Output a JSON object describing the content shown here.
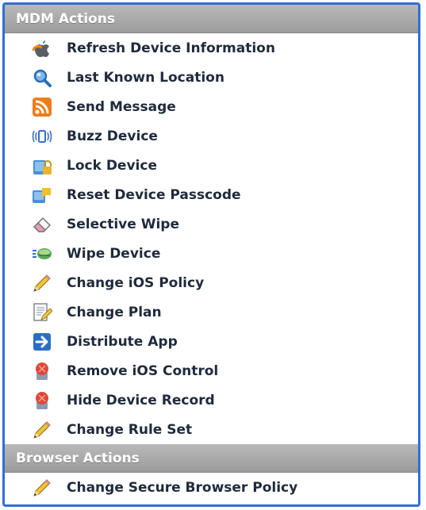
{
  "mdm": {
    "header": "MDM Actions",
    "items": [
      {
        "label": "Refresh Device Information",
        "icon": "apple-refresh-icon"
      },
      {
        "label": "Last Known Location",
        "icon": "magnifier-icon"
      },
      {
        "label": "Send Message",
        "icon": "rss-icon"
      },
      {
        "label": "Buzz Device",
        "icon": "vibrate-icon"
      },
      {
        "label": "Lock Device",
        "icon": "lock-icon"
      },
      {
        "label": "Reset Device Passcode",
        "icon": "passcode-icon"
      },
      {
        "label": "Selective Wipe",
        "icon": "eraser-icon"
      },
      {
        "label": "Wipe Device",
        "icon": "wipe-icon"
      },
      {
        "label": "Change iOS Policy",
        "icon": "pencil-icon"
      },
      {
        "label": "Change Plan",
        "icon": "edit-document-icon"
      },
      {
        "label": "Distribute App",
        "icon": "arrow-right-icon"
      },
      {
        "label": "Remove iOS Control",
        "icon": "remove-control-icon"
      },
      {
        "label": "Hide Device Record",
        "icon": "hide-record-icon"
      },
      {
        "label": "Change Rule Set",
        "icon": "pencil-icon"
      }
    ]
  },
  "browser": {
    "header": "Browser Actions",
    "items": [
      {
        "label": "Change Secure Browser Policy",
        "icon": "pencil-icon"
      }
    ]
  },
  "colors": {
    "border": "#2f6fd6",
    "header_bg": "#a8a8a8",
    "label": "#1f2a3c"
  }
}
